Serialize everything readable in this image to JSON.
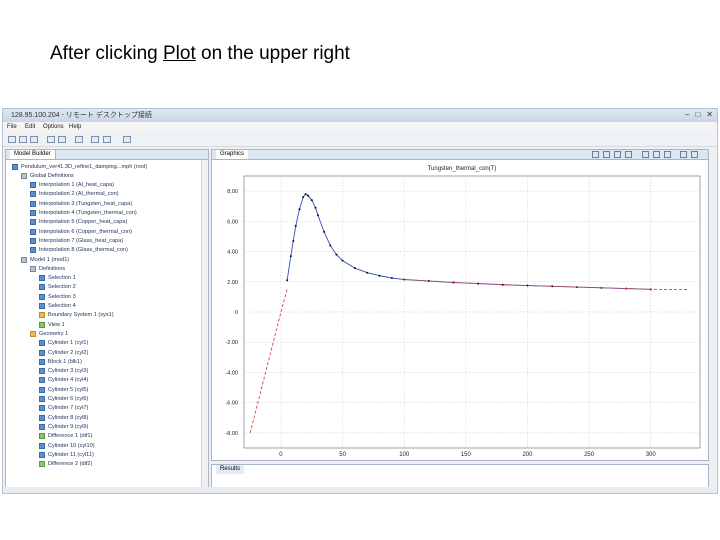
{
  "slide": {
    "prefix": "After clicking ",
    "plot_word": "Plot",
    "suffix": " on the upper right"
  },
  "window": {
    "title": "128.95.100.204 - リモート デスクトップ接続"
  },
  "menu": [
    "File",
    "Edit",
    "Options",
    "Help"
  ],
  "model_builder": {
    "tab": "Model Builder",
    "tree": [
      {
        "label": "Pendulum_ver41.3D_refine1_damping...mph (root)",
        "indent": 0,
        "icon": "blue"
      },
      {
        "label": "Global Definitions",
        "indent": 1,
        "icon": "gray"
      },
      {
        "label": "Interpolation 1 (Al_heat_capa)",
        "indent": 2,
        "icon": "blue"
      },
      {
        "label": "Interpolation 2 (Al_thermal_con)",
        "indent": 2,
        "icon": "blue"
      },
      {
        "label": "Interpolation 3 (Tungsten_heat_capa)",
        "indent": 2,
        "icon": "blue"
      },
      {
        "label": "Interpolation 4 (Tungsten_thermal_con)",
        "indent": 2,
        "icon": "blue"
      },
      {
        "label": "Interpolation 5 (Copper_heat_capa)",
        "indent": 2,
        "icon": "blue"
      },
      {
        "label": "Interpolation 6 (Copper_thermal_con)",
        "indent": 2,
        "icon": "blue"
      },
      {
        "label": "Interpolation 7 (Glass_heat_capa)",
        "indent": 2,
        "icon": "blue"
      },
      {
        "label": "Interpolation 8 (Glass_thermal_con)",
        "indent": 2,
        "icon": "blue"
      },
      {
        "label": "Model 1 (mod1)",
        "indent": 1,
        "icon": "gray"
      },
      {
        "label": "Definitions",
        "indent": 2,
        "icon": "gray"
      },
      {
        "label": "Selection 1",
        "indent": 3,
        "icon": "blue"
      },
      {
        "label": "Selection 2",
        "indent": 3,
        "icon": "blue"
      },
      {
        "label": "Selection 3",
        "indent": 3,
        "icon": "blue"
      },
      {
        "label": "Selection 4",
        "indent": 3,
        "icon": "blue"
      },
      {
        "label": "Boundary System 1 (sys1)",
        "indent": 3,
        "icon": "orange"
      },
      {
        "label": "View 1",
        "indent": 3,
        "icon": "green"
      },
      {
        "label": "Geometry 1",
        "indent": 2,
        "icon": "orange"
      },
      {
        "label": "Cylinder 1 (cyl1)",
        "indent": 3,
        "icon": "blue"
      },
      {
        "label": "Cylinder 2 (cyl2)",
        "indent": 3,
        "icon": "blue"
      },
      {
        "label": "Block 1 (blk1)",
        "indent": 3,
        "icon": "blue"
      },
      {
        "label": "Cylinder 3 (cyl3)",
        "indent": 3,
        "icon": "blue"
      },
      {
        "label": "Cylinder 4 (cyl4)",
        "indent": 3,
        "icon": "blue"
      },
      {
        "label": "Cylinder 5 (cyl5)",
        "indent": 3,
        "icon": "blue"
      },
      {
        "label": "Cylinder 6 (cyl6)",
        "indent": 3,
        "icon": "blue"
      },
      {
        "label": "Cylinder 7 (cyl7)",
        "indent": 3,
        "icon": "blue"
      },
      {
        "label": "Cylinder 8 (cyl8)",
        "indent": 3,
        "icon": "blue"
      },
      {
        "label": "Cylinder 9 (cyl9)",
        "indent": 3,
        "icon": "blue"
      },
      {
        "label": "Difference 1 (dif1)",
        "indent": 3,
        "icon": "green"
      },
      {
        "label": "Cylinder 10 (cyl10)",
        "indent": 3,
        "icon": "blue"
      },
      {
        "label": "Cylinder 11 (cyl11)",
        "indent": 3,
        "icon": "blue"
      },
      {
        "label": "Difference 2 (dif2)",
        "indent": 3,
        "icon": "green"
      }
    ]
  },
  "graphics": {
    "tab": "Graphics"
  },
  "results": {
    "tab": "Results"
  },
  "chart_data": {
    "type": "line",
    "title": "Tungsten_thermal_con(T)",
    "xlim": [
      -30,
      340
    ],
    "ylim": [
      -900,
      900
    ],
    "x_ticks": [
      0,
      50,
      100,
      150,
      200,
      250,
      300
    ],
    "y_ticks": [
      -800,
      -600,
      -400,
      -200,
      0,
      200,
      400,
      600,
      800
    ],
    "y_tick_labels": [
      "-8.00",
      "-6.00",
      "-4.00",
      "-2.00",
      "0",
      "2.00",
      "4.00",
      "6.00",
      "8.00"
    ],
    "grid": true,
    "series": [
      {
        "style": "dashed-red",
        "x": [
          -25,
          -20,
          -15,
          -10,
          -5,
          0,
          2,
          5
        ],
        "y": [
          -800,
          -640,
          -480,
          -320,
          -160,
          0,
          60,
          150
        ]
      },
      {
        "style": "solid-blue",
        "x": [
          5,
          8,
          10,
          12,
          15,
          18,
          20,
          22,
          25,
          28,
          30,
          35,
          40,
          45,
          50,
          60,
          70,
          80,
          90,
          100,
          120,
          140,
          160,
          180,
          200,
          220,
          240,
          260,
          280,
          300
        ],
        "y": [
          210,
          370,
          470,
          570,
          680,
          760,
          780,
          770,
          740,
          690,
          640,
          530,
          440,
          380,
          340,
          290,
          260,
          240,
          225,
          215,
          205,
          195,
          188,
          180,
          175,
          170,
          165,
          160,
          155,
          150
        ]
      },
      {
        "style": "dashed-red",
        "x": [
          100,
          150,
          200,
          250,
          300,
          330
        ],
        "y": [
          215,
          192,
          175,
          163,
          150,
          148
        ]
      }
    ]
  }
}
